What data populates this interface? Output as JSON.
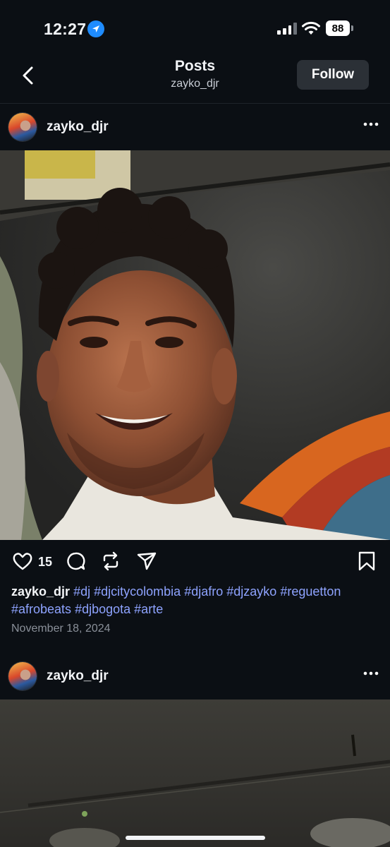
{
  "status_bar": {
    "time": "12:27",
    "battery": "88"
  },
  "header": {
    "title": "Posts",
    "subtitle": "zayko_djr",
    "follow_label": "Follow"
  },
  "posts": [
    {
      "username": "zayko_djr",
      "likes": "15",
      "caption_user": "zayko_djr",
      "hashtags": [
        "#dj",
        "#djcitycolombia",
        "#djafro",
        "#djzayko",
        "#reguetton",
        "#afrobeats",
        "#djbogota",
        "#arte"
      ],
      "date": "November 18, 2024"
    },
    {
      "username": "zayko_djr"
    }
  ],
  "icons": {
    "location": "location-arrow-icon",
    "back": "chevron-left-icon",
    "more": "more-horizontal-icon",
    "like": "heart-icon",
    "comment": "comment-icon",
    "repost": "repost-icon",
    "share": "send-icon",
    "save": "bookmark-icon"
  },
  "colors": {
    "background": "#0b0f14",
    "hashtag": "#8ea3ff",
    "follow_bg": "#2b3036"
  }
}
